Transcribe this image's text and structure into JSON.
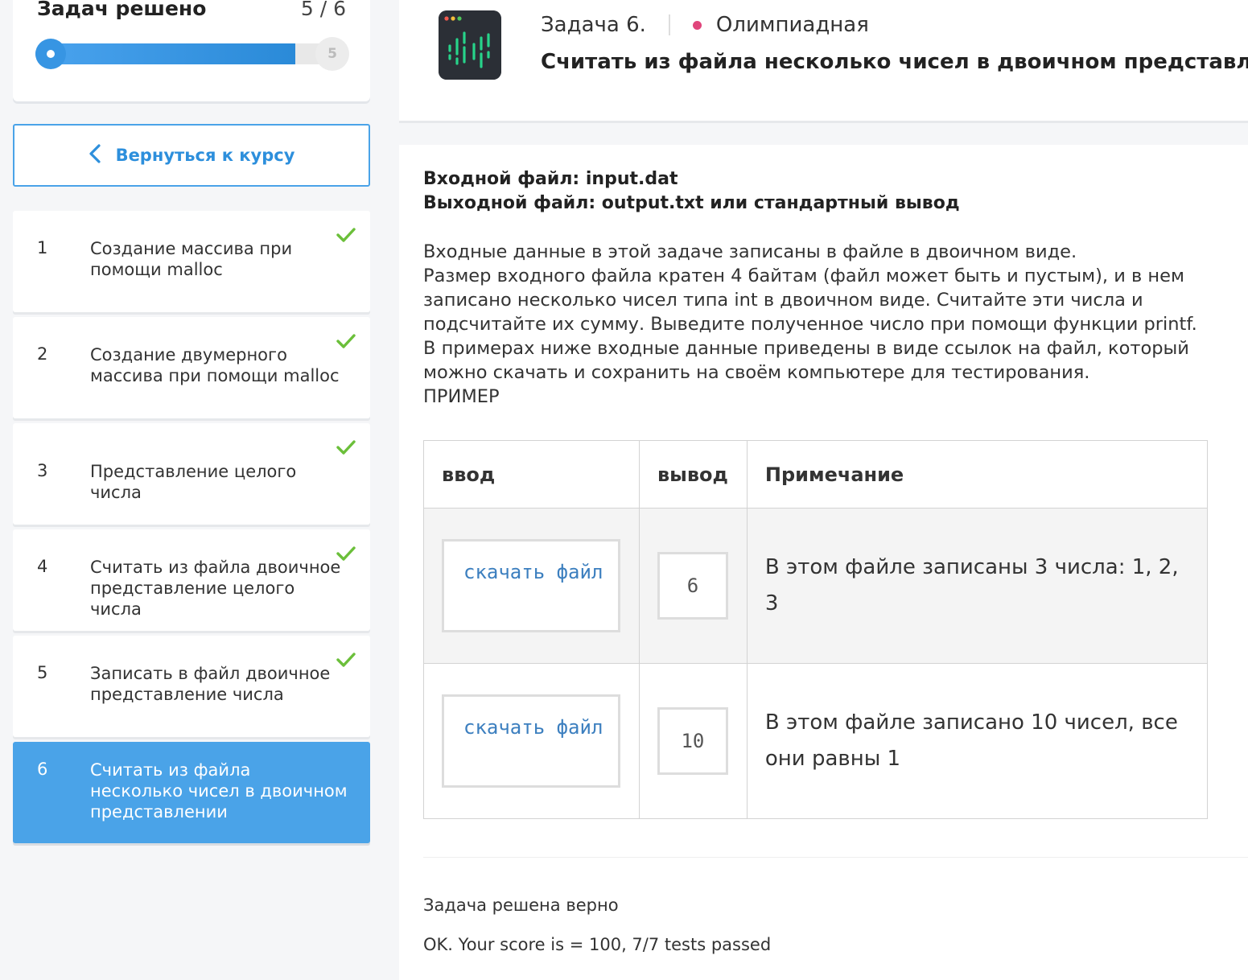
{
  "progress": {
    "title": "Задач решено",
    "count_text": "5 / 6",
    "end_marker": "5",
    "solved": 5,
    "total": 6
  },
  "back_button": {
    "label": "Вернуться к курсу",
    "icon": "chevron-left-icon"
  },
  "tasks": [
    {
      "num": "1",
      "label": "Создание массива при помощи malloc",
      "solved": true
    },
    {
      "num": "2",
      "label": "Создание двумерного массива при помощи malloc",
      "solved": true
    },
    {
      "num": "3",
      "label": "Представление целого числа",
      "solved": true
    },
    {
      "num": "4",
      "label": "Считать из файла двоичное представление целого числа",
      "solved": true
    },
    {
      "num": "5",
      "label": "Записать в файл двоичное представление числа",
      "solved": true
    },
    {
      "num": "6",
      "label": "Считать из файла несколько чисел в двоичном представлении",
      "solved": false,
      "active": true
    }
  ],
  "header": {
    "task_number": "Задача 6.",
    "kind": "Олимпиадная",
    "kind_color": "#e0457b",
    "title": "Считать из файла несколько чисел в двоичном представлении",
    "icon": "terminal-chart-icon"
  },
  "content": {
    "input_file": "Входной файл: input.dat",
    "output_file": "Выходной файл: output.txt или стандартный вывод",
    "description": "Входные данные в этой задаче записаны в файле в двоичном виде.\nРазмер входного файла кратен 4 байтам (файл может быть и пустым), и в нем\nзаписано несколько чисел типа int в двоичном виде. Считайте эти числа и\nподсчитайте их сумму. Выведите полученное число при помощи функции printf.\nВ примерах ниже входные данные приведены в виде ссылок на файл, который\nможно скачать и сохранить на своём компьютере для тестирования.\nПРИМЕР",
    "table": {
      "headers": [
        "ввод",
        "вывод",
        "Примечание"
      ],
      "rows": [
        {
          "input": "скачать файл",
          "output": "6",
          "note": "В этом файле записаны 3 числа: 1, 2, 3"
        },
        {
          "input": "скачать файл",
          "output": "10",
          "note": "В этом файле записано 10 чисел, все они равны 1"
        }
      ]
    }
  },
  "result": {
    "status": "Задача решена верно",
    "score": "OK. Your score is = 100, 7/7 tests passed"
  },
  "colors": {
    "accent": "#4aa3e8",
    "check": "#6bbf3a",
    "link": "#3c7fbf"
  }
}
